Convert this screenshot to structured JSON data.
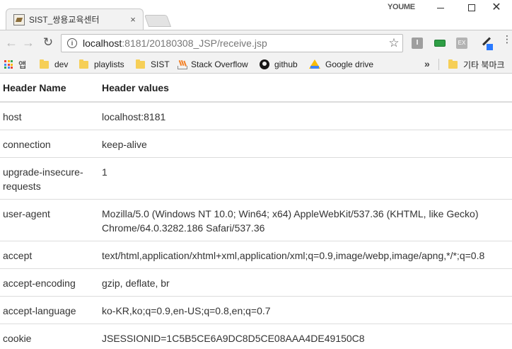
{
  "window": {
    "tab_title": "SIST_쌍용교육센터",
    "tab_close": "×",
    "profile_name": "YOUME"
  },
  "toolbar": {
    "url_host": "localhost",
    "url_rest": ":8181/20180308_JSP/receive.jsp",
    "ext1_label": "I",
    "ext3_label": "EX"
  },
  "bookmarks": {
    "items": [
      {
        "label": "앱",
        "icon": "apps-icon"
      },
      {
        "label": "dev",
        "icon": "folder-icon"
      },
      {
        "label": "playlists",
        "icon": "folder-icon"
      },
      {
        "label": "SIST",
        "icon": "folder-icon"
      },
      {
        "label": "Stack Overflow",
        "icon": "stackoverflow-icon"
      },
      {
        "label": "github",
        "icon": "github-icon"
      },
      {
        "label": "Google drive",
        "icon": "google-drive-icon"
      }
    ],
    "more": "»",
    "other_bookmarks": "기타 북마크"
  },
  "table": {
    "headers": [
      "Header Name",
      "Header values"
    ],
    "rows": [
      {
        "name": "host",
        "value": "localhost:8181"
      },
      {
        "name": "connection",
        "value": "keep-alive"
      },
      {
        "name": "upgrade-insecure-requests",
        "value": "1"
      },
      {
        "name": "user-agent",
        "value": "Mozilla/5.0 (Windows NT 10.0; Win64; x64) AppleWebKit/537.36 (KHTML, like Gecko) Chrome/64.0.3282.186 Safari/537.36"
      },
      {
        "name": "accept",
        "value": "text/html,application/xhtml+xml,application/xml;q=0.9,image/webp,image/apng,*/*;q=0.8"
      },
      {
        "name": "accept-encoding",
        "value": "gzip, deflate, br"
      },
      {
        "name": "accept-language",
        "value": "ko-KR,ko;q=0.9,en-US;q=0.8,en;q=0.7"
      },
      {
        "name": "cookie",
        "value": "JSESSIONID=1C5B5CE6A9DC8D5CE08AAA4DE49150C8"
      }
    ]
  }
}
